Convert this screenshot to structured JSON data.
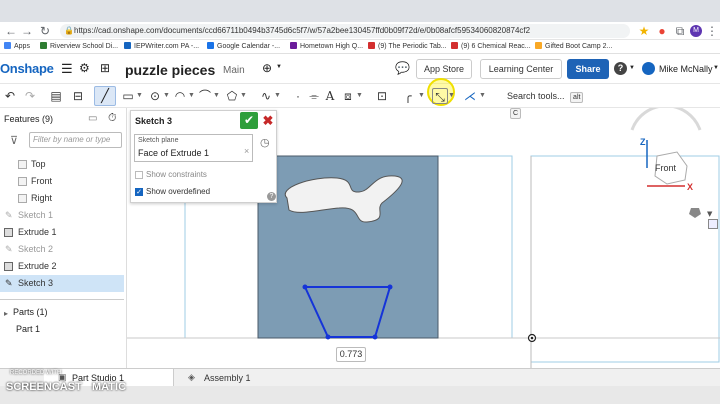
{
  "browser": {
    "url": "https://cad.onshape.com/documents/ccd66711b0494b3745d6c5f7/w/57a2bee130457ffd0b09f72d/e/0b08afcf59534060820874cf2",
    "bookmarks": [
      {
        "label": "Apps",
        "color": "#4285f4"
      },
      {
        "label": "Riverview School Di...",
        "color": "#2e7d32"
      },
      {
        "label": "IEPWriter.com PA -...",
        "color": "#1565c0"
      },
      {
        "label": "Google Calendar -...",
        "color": "#1a73e8"
      },
      {
        "label": "Hometown High Q...",
        "color": "#6a1b9a"
      },
      {
        "label": "(9) The Periodic Tab...",
        "color": "#d32f2f"
      },
      {
        "label": "(9) 6 Chemical Reac...",
        "color": "#d32f2f"
      },
      {
        "label": "Gifted Boot Camp 2...",
        "color": "#f9a825"
      }
    ],
    "profile_initial": "M"
  },
  "header": {
    "logo": "Onshape",
    "doc_title": "puzzle pieces",
    "branch": "Main",
    "app_store": "App Store",
    "learning_center": "Learning Center",
    "share": "Share",
    "user_name": "Mike McNally"
  },
  "toolbar": {
    "search_label": "Search tools...",
    "shortcut_alt": "alt",
    "shortcut_c": "C"
  },
  "features": {
    "header": "Features (9)",
    "filter_placeholder": "Filter by name or type",
    "items": [
      {
        "label": "Top",
        "kind": "plane"
      },
      {
        "label": "Front",
        "kind": "plane"
      },
      {
        "label": "Right",
        "kind": "plane"
      },
      {
        "label": "Sketch 1",
        "kind": "sketch-hidden"
      },
      {
        "label": "Extrude 1",
        "kind": "extrude"
      },
      {
        "label": "Sketch 2",
        "kind": "sketch-hidden"
      },
      {
        "label": "Extrude 2",
        "kind": "extrude"
      },
      {
        "label": "Sketch 3",
        "kind": "sketch-active"
      }
    ],
    "parts_header": "Parts (1)",
    "parts": [
      "Part 1"
    ]
  },
  "sketch_dialog": {
    "title": "Sketch 3",
    "plane_label": "Sketch plane",
    "plane_value": "Face of Extrude 1",
    "show_constraints": "Show constraints",
    "show_constraints_checked": false,
    "show_overdefined": "Show overdefined",
    "show_overdefined_checked": true,
    "help": "?"
  },
  "viewport": {
    "dimension": "0.773",
    "view_cube_label": "Front",
    "axis_z": "Z",
    "axis_x": "X"
  },
  "tabs": {
    "part_studio": "Part Studio 1",
    "assembly": "Assembly 1"
  },
  "watermark": {
    "line1": "RECORDED WITH",
    "line2": "SCREENCAST",
    "line3": "MATIC"
  }
}
